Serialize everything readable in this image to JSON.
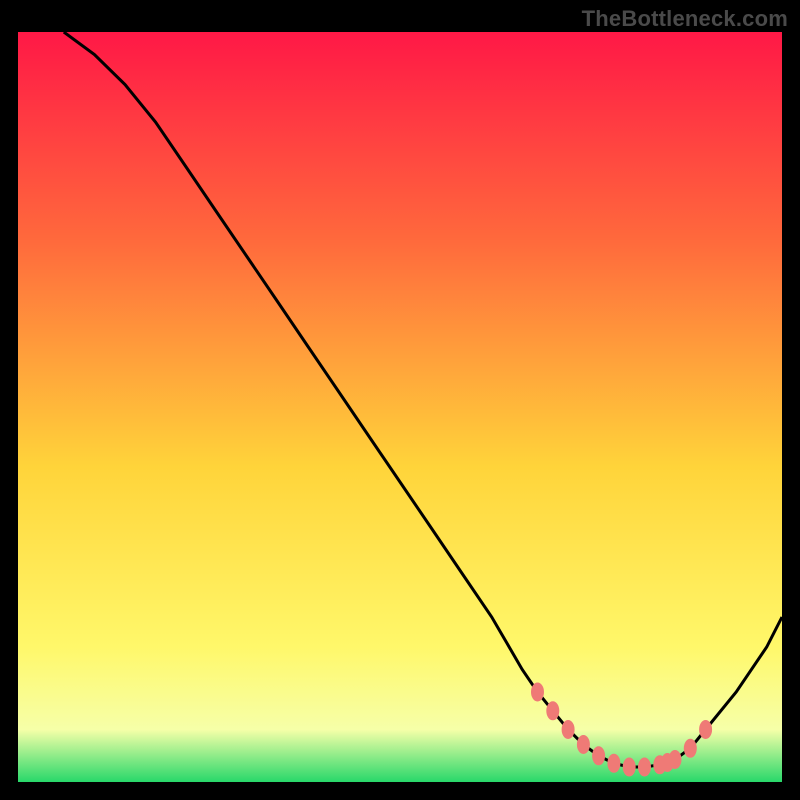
{
  "watermark": "TheBottleneck.com",
  "colors": {
    "frame": "#000000",
    "watermark": "#4a4a4a",
    "gradient_top": "#ff1846",
    "gradient_upper": "#ff6a3c",
    "gradient_mid": "#ffd43a",
    "gradient_lower": "#fff86a",
    "gradient_pale": "#f6ffa8",
    "gradient_green": "#28d86a",
    "curve_stroke": "#000000",
    "marker_fill": "#ef7a76",
    "marker_stroke": "#ef7a76"
  },
  "chart_data": {
    "type": "line",
    "title": "",
    "xlabel": "",
    "ylabel": "",
    "xlim": [
      0,
      100
    ],
    "ylim": [
      0,
      100
    ],
    "series": [
      {
        "name": "bottleneck-curve",
        "x": [
          6,
          10,
          14,
          18,
          22,
          26,
          30,
          34,
          38,
          42,
          46,
          50,
          54,
          58,
          62,
          64,
          66,
          68,
          70,
          72,
          74,
          76,
          78,
          80,
          82,
          84,
          86,
          88,
          90,
          94,
          98,
          100
        ],
        "y": [
          100,
          97,
          93,
          88,
          82,
          76,
          70,
          64,
          58,
          52,
          46,
          40,
          34,
          28,
          22,
          18.5,
          15,
          12,
          9.5,
          7,
          5,
          3.5,
          2.5,
          2,
          2,
          2.3,
          3,
          4.5,
          7,
          12,
          18,
          22
        ]
      }
    ],
    "markers": {
      "name": "highlight-dots",
      "x": [
        68,
        70,
        72,
        74,
        76,
        78,
        80,
        82,
        84,
        85,
        86,
        88,
        90
      ],
      "y": [
        12,
        9.5,
        7,
        5,
        3.5,
        2.5,
        2,
        2,
        2.3,
        2.6,
        3,
        4.5,
        7
      ]
    }
  }
}
